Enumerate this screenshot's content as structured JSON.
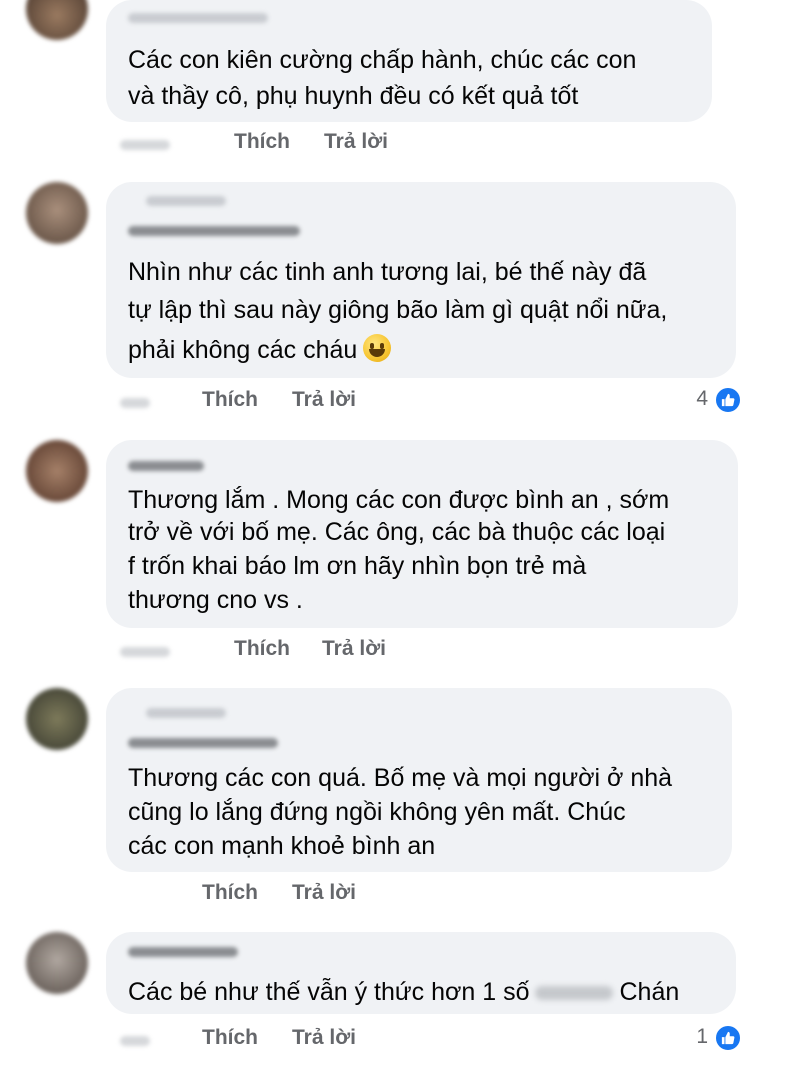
{
  "actions": {
    "like_label": "Thích",
    "reply_label": "Trả lời"
  },
  "comments": [
    {
      "author": "Phạm Ngọc Duy",
      "text_lines": [
        "Các con kiên cường chấp hành, chúc các con",
        "và thầy cô, phụ huynh đều có kết quả tốt"
      ]
    },
    {
      "author": "Alexander Ý Hải",
      "text_lines": [
        "Nhìn như các tinh anh tương lai, bé thế này đã",
        "tự lập thì sau này giông bão làm gì quật nổi nữa,",
        "phải không các cháu"
      ],
      "emoji_icon": "grinning-face-emoji",
      "reaction_count": "4",
      "reaction_icon": "like-reaction-icon"
    },
    {
      "author": "Hải Anh",
      "text_lines": [
        "Thương lắm . Mong các con được bình an , sớm",
        "trở về với bố mẹ. Các ông, các bà thuộc các loại",
        "f trốn khai báo lm ơn hãy nhìn bọn trẻ mà",
        "thương cno vs ."
      ]
    },
    {
      "author": "Đào Việt Nhật",
      "text_lines": [
        "Thương các con quá. Bố mẹ và mọi người ở nhà",
        "cũng lo lắng đứng ngồi không yên mất. Chúc",
        "các con mạnh khoẻ bình an"
      ]
    },
    {
      "author": "Lê Thùy Hiền",
      "text_before_redaction": "Các bé như thế vẫn ý thức hơn 1 số",
      "text_after_redaction": "Chán",
      "reaction_count": "1",
      "reaction_icon": "like-reaction-icon"
    }
  ],
  "colors": {
    "bubble_bg": "#f0f2f5",
    "action_text": "#65676b",
    "like_blue": "#1877f2"
  }
}
